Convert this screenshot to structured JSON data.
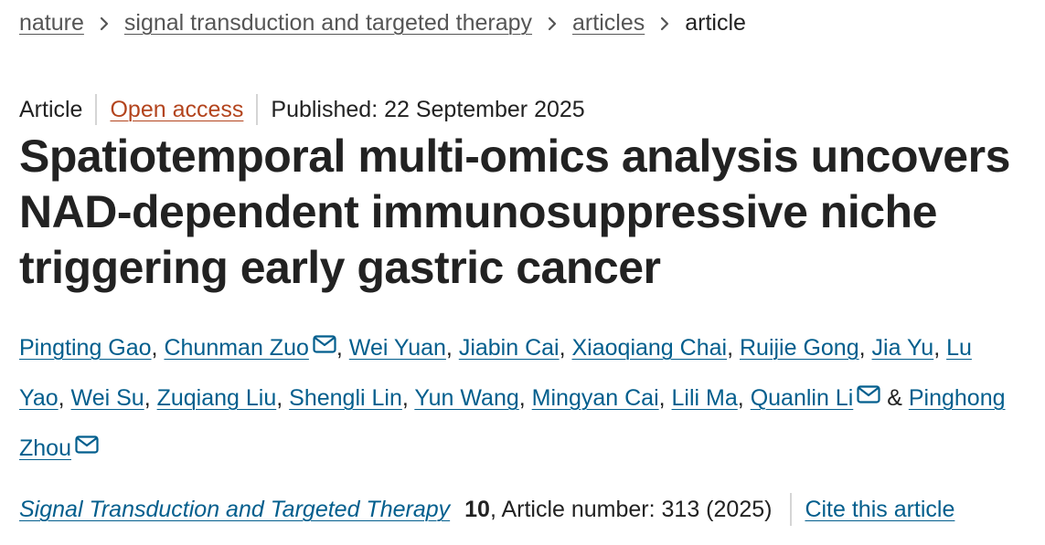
{
  "breadcrumb": {
    "items": [
      "nature",
      "signal transduction and targeted therapy",
      "articles"
    ],
    "current": "article"
  },
  "meta": {
    "type": "Article",
    "access": "Open access",
    "published": "Published: 22 September 2025"
  },
  "title": "Spatiotemporal multi-omics analysis uncovers NAD-dependent immunosuppressive niche triggering early gastric cancer",
  "authors": [
    {
      "name": "Pingting Gao",
      "mail": false
    },
    {
      "name": "Chunman Zuo",
      "mail": true
    },
    {
      "name": "Wei Yuan",
      "mail": false
    },
    {
      "name": "Jiabin Cai",
      "mail": false
    },
    {
      "name": "Xiaoqiang Chai",
      "mail": false
    },
    {
      "name": "Ruijie Gong",
      "mail": false
    },
    {
      "name": "Jia Yu",
      "mail": false
    },
    {
      "name": "Lu Yao",
      "mail": false
    },
    {
      "name": "Wei Su",
      "mail": false
    },
    {
      "name": "Zuqiang Liu",
      "mail": false
    },
    {
      "name": "Shengli Lin",
      "mail": false
    },
    {
      "name": "Yun Wang",
      "mail": false
    },
    {
      "name": "Mingyan Cai",
      "mail": false
    },
    {
      "name": "Lili Ma",
      "mail": false
    },
    {
      "name": "Quanlin Li",
      "mail": true
    },
    {
      "name": "Pinghong Zhou",
      "mail": true
    }
  ],
  "authors_separator": ", ",
  "authors_last_joiner": " & ",
  "citation": {
    "journal": "Signal Transduction and Targeted Therapy",
    "volume": "10",
    "article_number": ", Article number: 313 (2025)",
    "cite_label": "Cite this article"
  },
  "icons": {
    "breadcrumb_separator": "chevron-right-icon",
    "author_contact": "mail-icon"
  },
  "colors": {
    "link": "#025e8d",
    "open_access": "#b3441d",
    "breadcrumb_link": "#555555",
    "text": "#222222",
    "divider": "#d5d5d5"
  }
}
